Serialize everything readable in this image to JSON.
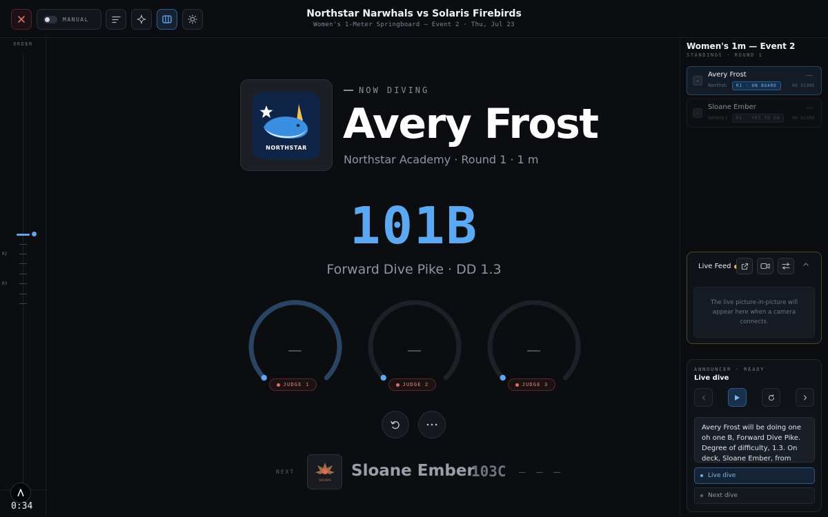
{
  "toolbar": {
    "manual_label": "MANUAL",
    "close_icon": "close-icon",
    "list_icon": "list-icon",
    "sparkle_icon": "sparkle-icon",
    "panel_icon": "panel-icon",
    "sun_icon": "sun-icon"
  },
  "header": {
    "title": "Northstar Narwhals vs Solaris Firebirds",
    "subtitle": "Women's 1-Meter Springboard — Event 2 · Thu, Jul 23"
  },
  "rail": {
    "label": "ORDER",
    "round_labels": [
      "R2",
      "R3"
    ],
    "timer": "0:34"
  },
  "stage": {
    "team_logo_text": "NORTHSTAR",
    "now_diving_label": "NOW DIVING",
    "diver_name": "Avery Frost",
    "diver_meta": "Northstar Academy · Round 1 · 1 m",
    "dive_code": "101B",
    "dive_description": "Forward Dive Pike · DD 1.3",
    "judges": [
      {
        "label": "JUDGE 1",
        "score": "—"
      },
      {
        "label": "JUDGE 2",
        "score": "—"
      },
      {
        "label": "JUDGE 3",
        "score": "—"
      }
    ],
    "next": {
      "label": "NEXT",
      "logo_text": "SOLARIS",
      "name": "Sloane Ember",
      "code": "103C",
      "placeholder": "– – –"
    }
  },
  "standings": {
    "title": "Women's 1m — Event 2",
    "subtitle": "STANDINGS · ROUND 1",
    "rows": [
      {
        "rank": "–",
        "name": "Avery Frost",
        "team": "Northstar Academy",
        "badge": "R1 · ON BOARD",
        "score_dash": "—",
        "score_label": "NO SCORE"
      },
      {
        "rank": "–",
        "name": "Sloane Ember",
        "team": "Solaris Prep",
        "badge": "R1 · YET TO GO",
        "score_dash": "—",
        "score_label": "NO SCORE"
      }
    ]
  },
  "live_feed": {
    "title": "Live Feed",
    "status_color": "#e9b84a",
    "placeholder": "The live picture-in-picture will appear here when a camera connects."
  },
  "announcer": {
    "status": "ANNOUNCER · READY",
    "title": "Live dive",
    "script": "Avery Frost will be doing one oh one B, Forward Dive Pike. Degree of difficulty, 1.3. On deck, Sloane Ember, from Solaris Prep.",
    "options": [
      "Live dive",
      "Next dive"
    ]
  },
  "colors": {
    "accent": "#5aa9f2",
    "judge_badge": "#e38c86",
    "live_feed_border": "#4b4722"
  }
}
